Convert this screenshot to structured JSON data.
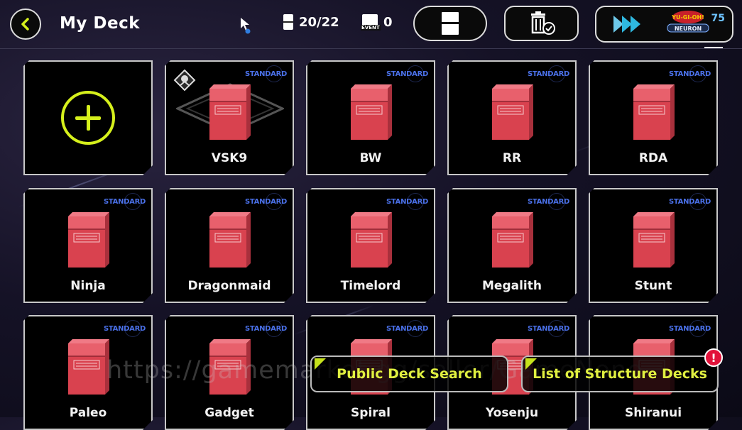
{
  "header": {
    "title": "My Deck",
    "deck_count": "20/22",
    "event_count": "0",
    "event_icon_label": "EVENT",
    "level": "75",
    "icons": [
      "back-arrow-icon",
      "card-icon",
      "event-icon",
      "card-sort-icon",
      "trash-check-icon",
      "chevron-icon",
      "neuron-logo"
    ]
  },
  "colors": {
    "accent_yellow": "#d6f01c",
    "deckbox_red": "#d9424f",
    "badge_blue": "#4a70e8",
    "alert_red": "#e2123a"
  },
  "deck_grid": {
    "new_deck_icon": "plus-icon",
    "decks": [
      {
        "name": "VSK9",
        "format": "STANDARD",
        "favorite": true
      },
      {
        "name": "BW",
        "format": "STANDARD"
      },
      {
        "name": "RR",
        "format": "STANDARD"
      },
      {
        "name": "RDA",
        "format": "STANDARD"
      },
      {
        "name": "Ninja",
        "format": "STANDARD"
      },
      {
        "name": "Dragonmaid",
        "format": "STANDARD"
      },
      {
        "name": "Timelord",
        "format": "STANDARD"
      },
      {
        "name": "Megalith",
        "format": "STANDARD"
      },
      {
        "name": "Stunt",
        "format": "STANDARD"
      },
      {
        "name": "Paleo",
        "format": "STANDARD"
      },
      {
        "name": "Gadget",
        "format": "STANDARD"
      },
      {
        "name": "Spiral",
        "format": "STANDARD"
      },
      {
        "name": "Yosenju",
        "format": "STANDARD"
      },
      {
        "name": "Shiranui",
        "format": "STANDARD"
      }
    ]
  },
  "actions": {
    "public_search": "Public Deck Search",
    "structure_decks": "List of Structure Decks",
    "notification": "!"
  },
  "watermark": "https://gamemarket.gg/seller/GameNone"
}
